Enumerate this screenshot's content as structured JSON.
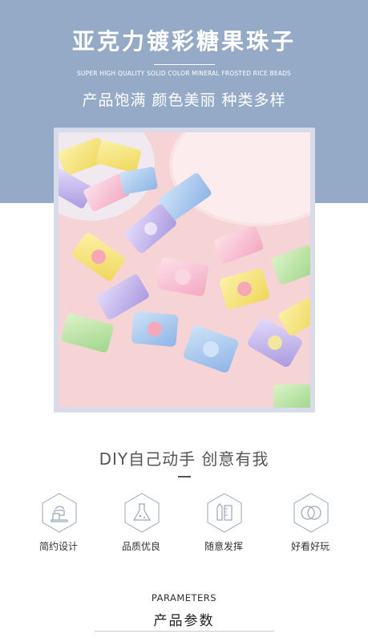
{
  "hero": {
    "title": "亚克力镀彩糖果珠子",
    "subtitle": "SUPER HIGH QUALITY SOLID COLOR MINERAL FROSTED RICE BEADS",
    "tagline": "产品饱满  颜色美丽  种类多样",
    "background_color": "#95aac6"
  },
  "photo": {
    "content": "pastel candy-shaped acrylic beads on pink background",
    "colors": [
      "#f6d4d6",
      "#a8c8ea",
      "#f4e27a",
      "#bfe6a6",
      "#c6b4ea",
      "#f8b9c9"
    ]
  },
  "section": {
    "title": "DIY自己动手  创意有我"
  },
  "features": [
    {
      "label": "简约设计",
      "icon": "mixer-icon"
    },
    {
      "label": "品质优良",
      "icon": "flask-icon"
    },
    {
      "label": "随意发挥",
      "icon": "pencil-ruler-icon"
    },
    {
      "label": "好看好玩",
      "icon": "rings-icon"
    }
  ],
  "params": {
    "en": "PARAMETERS",
    "cn": "产品参数"
  }
}
